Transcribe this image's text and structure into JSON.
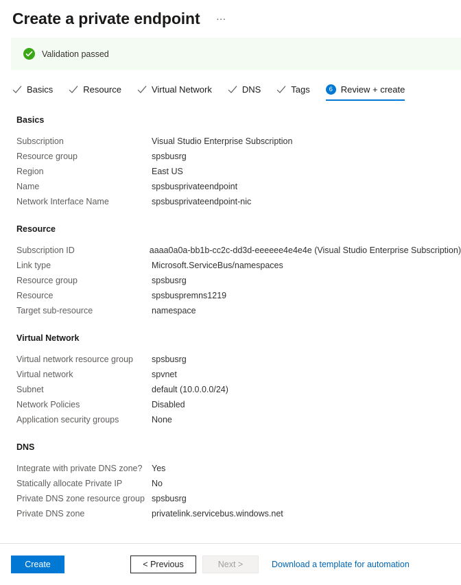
{
  "header": {
    "title": "Create a private endpoint",
    "more_menu": "…"
  },
  "banner": {
    "text": "Validation passed",
    "icon": "check-circle-icon",
    "background_color": "#f4fbf2",
    "icon_color": "#3aa716"
  },
  "tabs": [
    {
      "label": "Basics",
      "state": "complete",
      "icon": "check-icon"
    },
    {
      "label": "Resource",
      "state": "complete",
      "icon": "check-icon"
    },
    {
      "label": "Virtual Network",
      "state": "complete",
      "icon": "check-icon"
    },
    {
      "label": "DNS",
      "state": "complete",
      "icon": "check-icon"
    },
    {
      "label": "Tags",
      "state": "complete",
      "icon": "check-icon"
    },
    {
      "label": "Review + create",
      "state": "active",
      "badge": "6"
    }
  ],
  "sections": [
    {
      "title": "Basics",
      "rows": [
        {
          "label": "Subscription",
          "value": "Visual Studio Enterprise Subscription"
        },
        {
          "label": "Resource group",
          "value": "spsbusrg"
        },
        {
          "label": "Region",
          "value": "East US"
        },
        {
          "label": "Name",
          "value": "spsbusprivateendpoint"
        },
        {
          "label": "Network Interface Name",
          "value": "spsbusprivateendpoint-nic"
        }
      ]
    },
    {
      "title": "Resource",
      "rows": [
        {
          "label": "Subscription ID",
          "value": "aaaa0a0a-bb1b-cc2c-dd3d-eeeeee4e4e4e (Visual Studio Enterprise Subscription)"
        },
        {
          "label": "Link type",
          "value": "Microsoft.ServiceBus/namespaces"
        },
        {
          "label": "Resource group",
          "value": "spsbusrg"
        },
        {
          "label": "Resource",
          "value": "spsbuspremns1219"
        },
        {
          "label": "Target sub-resource",
          "value": "namespace"
        }
      ]
    },
    {
      "title": "Virtual Network",
      "rows": [
        {
          "label": "Virtual network resource group",
          "value": "spsbusrg"
        },
        {
          "label": "Virtual network",
          "value": "spvnet"
        },
        {
          "label": "Subnet",
          "value": "default (10.0.0.0/24)"
        },
        {
          "label": "Network Policies",
          "value": "Disabled"
        },
        {
          "label": "Application security groups",
          "value": "None"
        }
      ]
    },
    {
      "title": "DNS",
      "rows": [
        {
          "label": "Integrate with private DNS zone?",
          "value": "Yes"
        },
        {
          "label": "Statically allocate Private IP",
          "value": "No"
        },
        {
          "label": "Private DNS zone resource group",
          "value": "spsbusrg"
        },
        {
          "label": "Private DNS zone",
          "value": "privatelink.servicebus.windows.net"
        }
      ]
    }
  ],
  "footer": {
    "create_label": "Create",
    "previous_label": "< Previous",
    "next_label": "Next >",
    "next_disabled": true,
    "download_template_label": "Download a template for automation",
    "accent_color": "#0078d4",
    "link_color": "#0065b3"
  }
}
